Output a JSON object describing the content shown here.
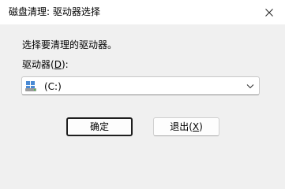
{
  "window": {
    "title": "磁盘清理: 驱动器选择",
    "close_icon": "close-icon"
  },
  "dialog": {
    "prompt": "选择要清理的驱动器。",
    "drive_label_prefix": "驱动器(",
    "drive_label_access_key": "D",
    "drive_label_suffix": "):",
    "drive_select": {
      "icon": "drive-icon",
      "selected_value": "(C:)"
    }
  },
  "buttons": {
    "ok_label": "确定",
    "exit_label_prefix": "退出(",
    "exit_label_access_key": "X",
    "exit_label_suffix": ")"
  }
}
